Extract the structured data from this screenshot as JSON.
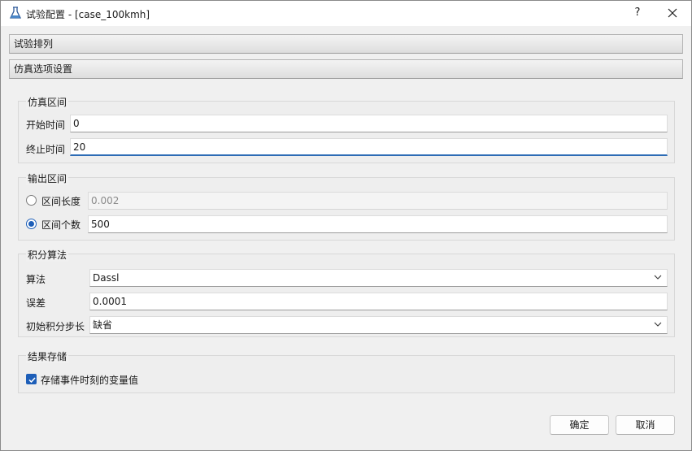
{
  "window": {
    "title": "试验配置 - [case_100kmh]",
    "help_label": "?",
    "icons": {
      "app": "flask-icon",
      "close": "close-icon"
    }
  },
  "sections": [
    {
      "label": "试验排列"
    },
    {
      "label": "仿真选项设置"
    }
  ],
  "simulation_interval": {
    "title": "仿真区间",
    "start_time": {
      "label": "开始时间",
      "value": "0"
    },
    "end_time": {
      "label": "终止时间",
      "value": "20"
    }
  },
  "output_interval": {
    "title": "输出区间",
    "interval_length": {
      "label": "区间长度",
      "value": "0.002",
      "selected": false,
      "enabled": false
    },
    "interval_count": {
      "label": "区间个数",
      "value": "500",
      "selected": true
    }
  },
  "integration": {
    "title": "积分算法",
    "algorithm": {
      "label": "算法",
      "value": "Dassl"
    },
    "tolerance": {
      "label": "误差",
      "value": "0.0001"
    },
    "initial_step": {
      "label": "初始积分步长",
      "value": "缺省"
    }
  },
  "result_storage": {
    "title": "结果存储",
    "store_event_values": {
      "label": "存储事件时刻的变量值",
      "checked": true
    }
  },
  "buttons": {
    "ok": "确定",
    "cancel": "取消"
  },
  "colors": {
    "accent": "#1d5eb8",
    "focus_underline": "#2d6cb5"
  }
}
